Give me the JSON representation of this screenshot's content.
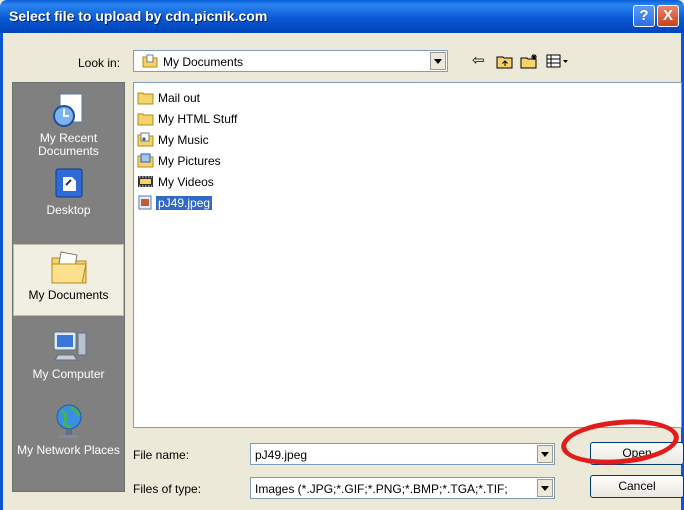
{
  "window": {
    "title": "Select file to upload by cdn.picnik.com",
    "help_label": "?",
    "close_label": "X"
  },
  "lookin": {
    "label": "Look in:",
    "value": "My Documents"
  },
  "places": [
    {
      "label": "My Recent Documents"
    },
    {
      "label": "Desktop"
    },
    {
      "label": "My Documents"
    },
    {
      "label": "My Computer"
    },
    {
      "label": "My Network Places"
    }
  ],
  "files": [
    {
      "name": "Mail out"
    },
    {
      "name": "My HTML Stuff"
    },
    {
      "name": "My Music"
    },
    {
      "name": "My Pictures"
    },
    {
      "name": "My Videos"
    },
    {
      "name": "pJ49.jpeg"
    }
  ],
  "filename": {
    "label": "File name:",
    "value": "pJ49.jpeg"
  },
  "filetype": {
    "label": "Files of type:",
    "value": "Images (*.JPG;*.GIF;*.PNG;*.BMP;*.TGA;*.TIF;"
  },
  "buttons": {
    "open": "Open",
    "cancel": "Cancel"
  },
  "colors": {
    "title_bar": "#0b58d5",
    "selection": "#316ac5",
    "annotation_ring": "#e21b1b"
  }
}
